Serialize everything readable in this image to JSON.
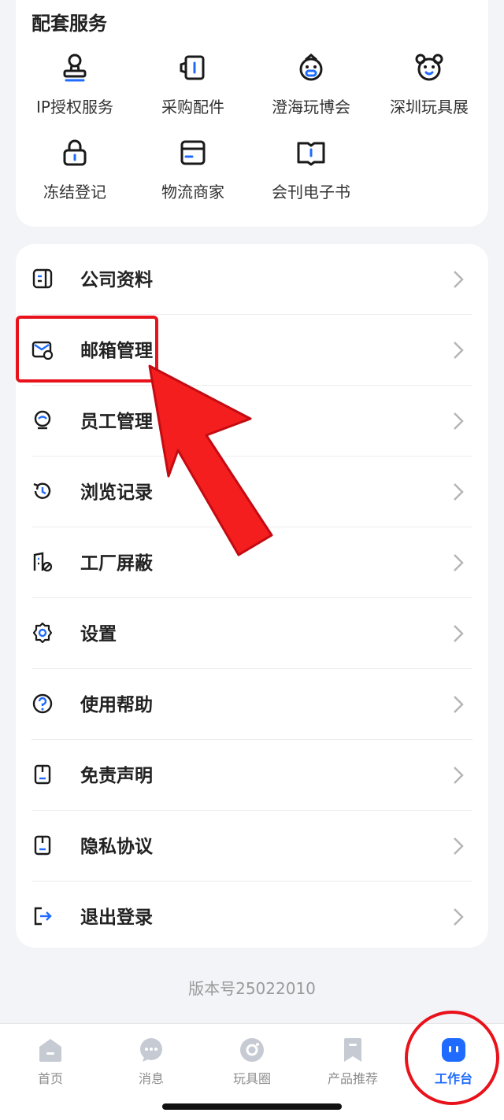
{
  "services": {
    "title": "配套服务",
    "items": [
      {
        "label": "IP授权服务",
        "icon": "stamp-icon"
      },
      {
        "label": "采购配件",
        "icon": "parts-icon"
      },
      {
        "label": "澄海玩博会",
        "icon": "expo-icon"
      },
      {
        "label": "深圳玩具展",
        "icon": "bear-icon"
      },
      {
        "label": "冻结登记",
        "icon": "lock-icon"
      },
      {
        "label": "物流商家",
        "icon": "box-icon"
      },
      {
        "label": "会刊电子书",
        "icon": "book-icon"
      }
    ]
  },
  "menu": {
    "items": [
      {
        "label": "公司资料",
        "icon": "company-card-icon"
      },
      {
        "label": "邮箱管理",
        "icon": "mail-settings-icon"
      },
      {
        "label": "员工管理",
        "icon": "employee-icon"
      },
      {
        "label": "浏览记录",
        "icon": "history-icon"
      },
      {
        "label": "工厂屏蔽",
        "icon": "factory-block-icon"
      },
      {
        "label": "设置",
        "icon": "gear-icon"
      },
      {
        "label": "使用帮助",
        "icon": "help-icon"
      },
      {
        "label": "免责声明",
        "icon": "disclaimer-icon"
      },
      {
        "label": "隐私协议",
        "icon": "privacy-icon"
      },
      {
        "label": "退出登录",
        "icon": "logout-icon"
      }
    ]
  },
  "version": "版本号25022010",
  "tabbar": {
    "tabs": [
      {
        "label": "首页",
        "icon": "home-icon"
      },
      {
        "label": "消息",
        "icon": "message-icon"
      },
      {
        "label": "玩具圈",
        "icon": "circle-icon"
      },
      {
        "label": "产品推荐",
        "icon": "bookmark-icon"
      },
      {
        "label": "工作台",
        "icon": "workbench-icon"
      }
    ],
    "active": "工作台"
  },
  "colors": {
    "accent": "#1F6BFF",
    "annotation_red": "#E8121B",
    "background": "#F3F4F8"
  }
}
